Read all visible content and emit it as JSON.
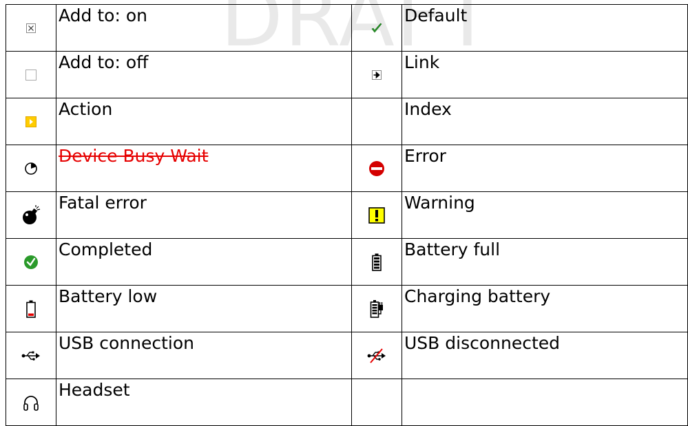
{
  "watermark": "DRAFT",
  "rows": [
    {
      "left": {
        "icon": "checkbox-checked-icon",
        "label": "Add to: on"
      },
      "right": {
        "icon": "green-check-icon",
        "label": "Default"
      }
    },
    {
      "left": {
        "icon": "checkbox-empty-icon",
        "label": "Add to: off"
      },
      "right": {
        "icon": "link-arrow-icon",
        "label": "Link"
      }
    },
    {
      "left": {
        "icon": "action-arrow-icon",
        "label": "Action"
      },
      "right": {
        "icon": "",
        "label": "Index"
      }
    },
    {
      "left": {
        "icon": "clock-wait-icon",
        "label": "Device Busy Wait",
        "style": "strikethrough-red"
      },
      "right": {
        "icon": "error-no-entry-icon",
        "label": "Error"
      }
    },
    {
      "left": {
        "icon": "bomb-icon",
        "label": "Fatal error"
      },
      "right": {
        "icon": "warning-exclamation-icon",
        "label": "Warning"
      }
    },
    {
      "left": {
        "icon": "completed-check-circle-icon",
        "label": "Completed"
      },
      "right": {
        "icon": "battery-full-icon",
        "label": "Battery full"
      }
    },
    {
      "left": {
        "icon": "battery-low-icon",
        "label": "Battery low"
      },
      "right": {
        "icon": "charging-battery-icon",
        "label": "Charging battery"
      }
    },
    {
      "left": {
        "icon": "usb-icon",
        "label": "USB connection"
      },
      "right": {
        "icon": "usb-disconnected-icon",
        "label": "USB disconnected"
      }
    },
    {
      "left": {
        "icon": "headset-icon",
        "label": "Headset"
      },
      "right": {
        "icon": "",
        "label": ""
      }
    }
  ],
  "colors": {
    "strike": "#e60000",
    "check_green": "#2a9a2a",
    "warning_yellow": "#ffff00",
    "error_red": "#d40000",
    "action_yellow": "#ffcc00"
  }
}
